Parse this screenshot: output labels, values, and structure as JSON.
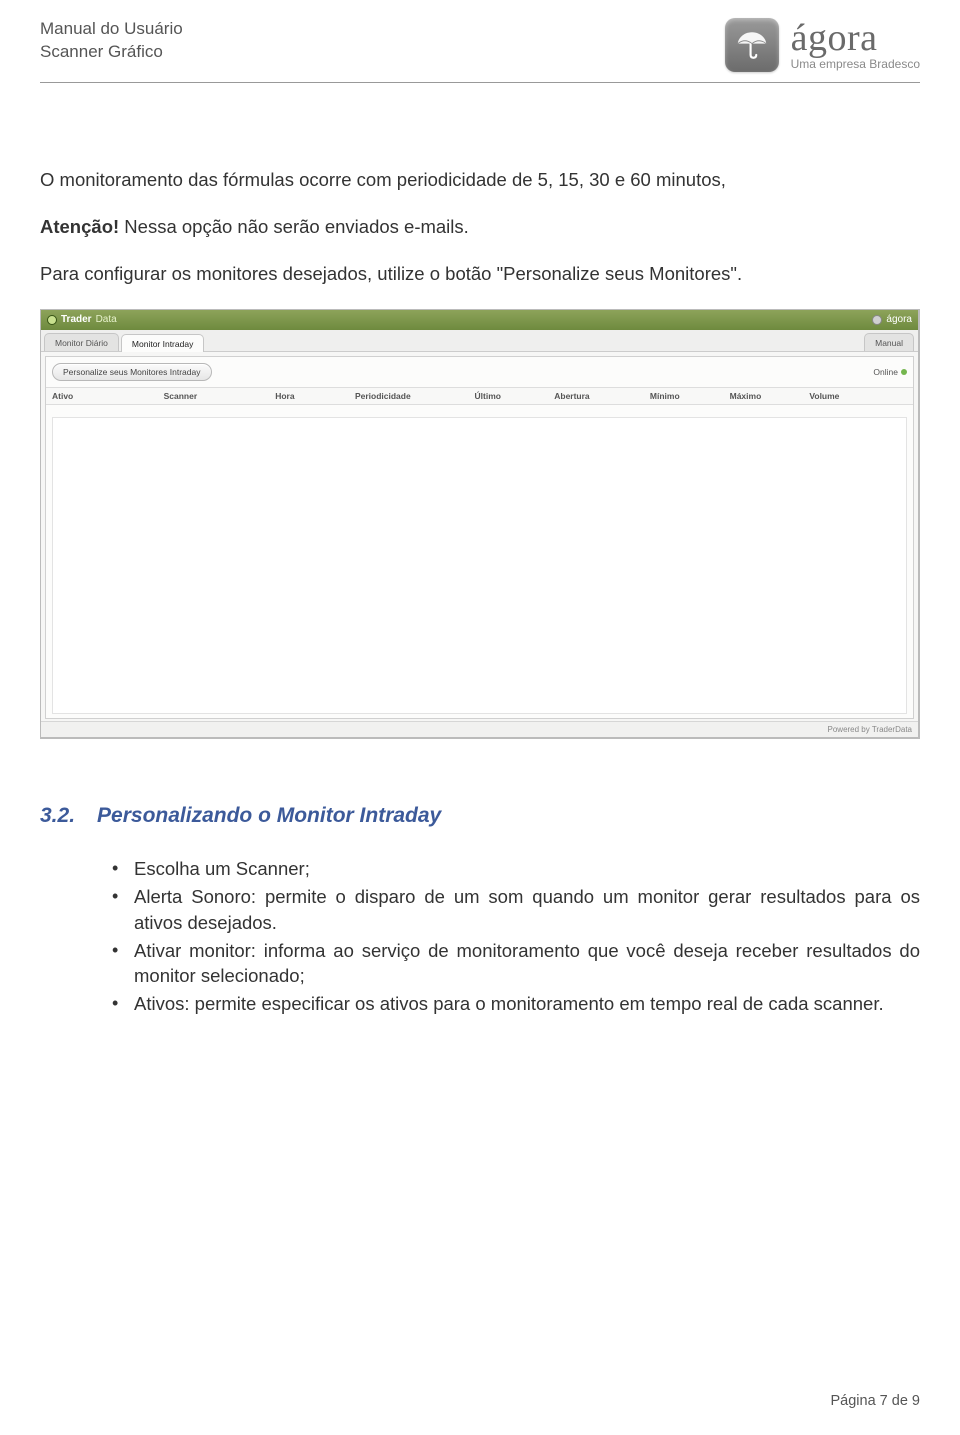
{
  "header": {
    "line1": "Manual do Usuário",
    "line2": "Scanner Gráfico"
  },
  "logo": {
    "brand": "ágora",
    "sub": "Uma empresa Bradesco"
  },
  "body": {
    "p1": "O monitoramento das fórmulas ocorre com periodicidade de 5, 15, 30 e 60 minutos,",
    "p2_bold": "Atenção!",
    "p2_rest": " Nessa opção não serão enviados e-mails.",
    "p3": "Para configurar os monitores desejados, utilize o botão \"Personalize seus Monitores\"."
  },
  "screenshot": {
    "title_app": "Trader",
    "title_suffix": "Data",
    "title_right": "ágora",
    "tab1": "Monitor Diário",
    "tab2": "Monitor Intraday",
    "tab_manual": "Manual",
    "button": "Personalize seus Monitores Intraday",
    "online": "Online",
    "columns": [
      "Ativo",
      "Scanner",
      "Hora",
      "Periodicidade",
      "Último",
      "Abertura",
      "Mínimo",
      "Máximo",
      "Volume"
    ],
    "powered_by": "Powered by TraderData"
  },
  "section": {
    "number": "3.2.",
    "title": "Personalizando o Monitor Intraday"
  },
  "bullets": {
    "b1": "Escolha um Scanner;",
    "b2": "Alerta Sonoro: permite o disparo de um som quando um monitor gerar resultados para os ativos desejados.",
    "b3": " Ativar monitor: informa ao serviço de monitoramento que você deseja receber resultados do monitor selecionado;",
    "b4": "Ativos: permite especificar os ativos para o monitoramento em tempo real de cada scanner."
  },
  "footer": {
    "page": "Página 7 de 9"
  }
}
